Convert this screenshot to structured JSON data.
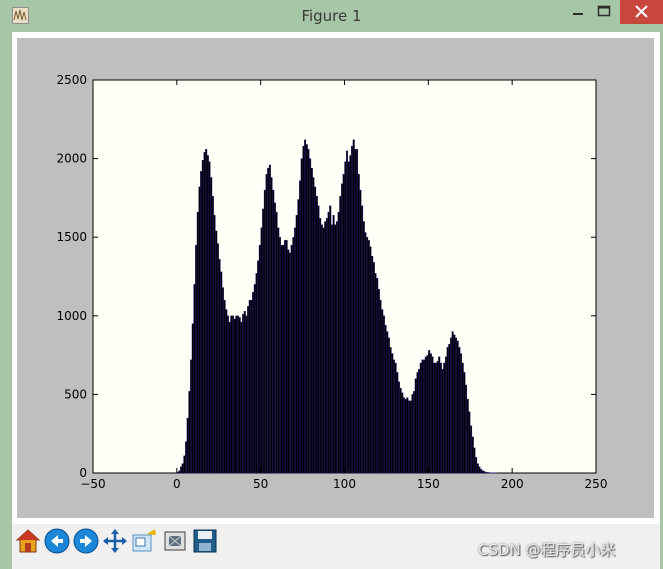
{
  "window": {
    "title": "Figure 1",
    "app_icon": "matplotlib-figure-icon",
    "controls": [
      "minimize-icon",
      "maximize-icon",
      "close-icon"
    ],
    "colors": {
      "frame": "#a7c5a7",
      "close": "#c7463e",
      "canvas_bg": "#bfbfbf"
    }
  },
  "toolbar": {
    "buttons": [
      {
        "name": "home",
        "icon": "home-icon"
      },
      {
        "name": "back",
        "icon": "back-arrow-icon"
      },
      {
        "name": "forward",
        "icon": "forward-arrow-icon"
      },
      {
        "name": "pan",
        "icon": "pan-move-icon"
      },
      {
        "name": "zoom",
        "icon": "zoom-rect-icon"
      },
      {
        "name": "subplots",
        "icon": "configure-subplots-icon"
      },
      {
        "name": "save",
        "icon": "save-floppy-icon"
      }
    ]
  },
  "watermark": "CSDN @程序员小米",
  "chart_data": {
    "type": "bar",
    "title": "",
    "xlabel": "",
    "ylabel": "",
    "xlim": [
      -50,
      250
    ],
    "ylim": [
      0,
      2500
    ],
    "xticks": [
      "−50",
      "0",
      "50",
      "100",
      "150",
      "200",
      "250"
    ],
    "yticks": [
      "0",
      "500",
      "1000",
      "1500",
      "2000",
      "2500"
    ],
    "grid": false,
    "bar_color": "#000000",
    "edge_color": "#2a1b8c",
    "x": [
      0,
      1,
      2,
      3,
      4,
      5,
      6,
      7,
      8,
      9,
      10,
      11,
      12,
      13,
      14,
      15,
      16,
      17,
      18,
      19,
      20,
      21,
      22,
      23,
      24,
      25,
      26,
      27,
      28,
      29,
      30,
      31,
      32,
      33,
      34,
      35,
      36,
      37,
      38,
      39,
      40,
      41,
      42,
      43,
      44,
      45,
      46,
      47,
      48,
      49,
      50,
      51,
      52,
      53,
      54,
      55,
      56,
      57,
      58,
      59,
      60,
      61,
      62,
      63,
      64,
      65,
      66,
      67,
      68,
      69,
      70,
      71,
      72,
      73,
      74,
      75,
      76,
      77,
      78,
      79,
      80,
      81,
      82,
      83,
      84,
      85,
      86,
      87,
      88,
      89,
      90,
      91,
      92,
      93,
      94,
      95,
      96,
      97,
      98,
      99,
      100,
      101,
      102,
      103,
      104,
      105,
      106,
      107,
      108,
      109,
      110,
      111,
      112,
      113,
      114,
      115,
      116,
      117,
      118,
      119,
      120,
      121,
      122,
      123,
      124,
      125,
      126,
      127,
      128,
      129,
      130,
      131,
      132,
      133,
      134,
      135,
      136,
      137,
      138,
      139,
      140,
      141,
      142,
      143,
      144,
      145,
      146,
      147,
      148,
      149,
      150,
      151,
      152,
      153,
      154,
      155,
      156,
      157,
      158,
      159,
      160,
      161,
      162,
      163,
      164,
      165,
      166,
      167,
      168,
      169,
      170,
      171,
      172,
      173,
      174,
      175,
      176,
      177,
      178,
      179,
      180,
      181,
      182,
      183,
      184,
      185,
      186,
      187,
      188,
      189,
      190,
      191,
      192,
      193,
      194,
      195,
      196,
      197,
      198,
      199,
      200,
      201,
      202,
      203,
      204,
      205,
      206,
      207,
      208,
      209,
      210,
      211,
      212,
      213,
      214,
      215,
      216,
      217,
      218,
      219,
      220,
      221,
      222,
      223,
      224,
      225,
      226,
      227,
      228,
      229,
      230,
      231,
      232,
      233,
      234,
      235,
      236,
      237,
      238,
      239,
      240
    ],
    "values": [
      5,
      15,
      40,
      60,
      110,
      200,
      350,
      520,
      720,
      950,
      1200,
      1450,
      1660,
      1820,
      1920,
      1990,
      2040,
      2060,
      2020,
      1980,
      1880,
      1760,
      1640,
      1540,
      1460,
      1360,
      1280,
      1180,
      1100,
      1040,
      1000,
      960,
      1000,
      1000,
      980,
      1000,
      1000,
      990,
      960,
      1010,
      1030,
      1000,
      1060,
      1100,
      1100,
      1150,
      1200,
      1270,
      1350,
      1450,
      1560,
      1680,
      1800,
      1900,
      1940,
      1960,
      1880,
      1800,
      1720,
      1660,
      1560,
      1500,
      1450,
      1450,
      1480,
      1480,
      1420,
      1400,
      1450,
      1500,
      1560,
      1640,
      1740,
      1860,
      2000,
      2080,
      2120,
      2090,
      2060,
      2000,
      1940,
      1880,
      1820,
      1760,
      1700,
      1620,
      1580,
      1560,
      1600,
      1620,
      1660,
      1700,
      1580,
      1640,
      1580,
      1600,
      1660,
      1760,
      1840,
      1900,
      1980,
      2050,
      1980,
      2020,
      2080,
      2120,
      2060,
      2060,
      1900,
      1800,
      1700,
      1600,
      1530,
      1500,
      1480,
      1440,
      1380,
      1340,
      1270,
      1240,
      1170,
      1100,
      1040,
      1000,
      940,
      900,
      860,
      800,
      760,
      720,
      700,
      640,
      580,
      540,
      510,
      480,
      470,
      480,
      460,
      460,
      500,
      520,
      600,
      640,
      660,
      700,
      720,
      720,
      740,
      750,
      780,
      760,
      740,
      700,
      700,
      710,
      740,
      700,
      660,
      700,
      740,
      800,
      820,
      860,
      900,
      880,
      860,
      840,
      800,
      760,
      700,
      640,
      560,
      470,
      390,
      300,
      230,
      160,
      100,
      60,
      40,
      25,
      15,
      10,
      5,
      4,
      3,
      2,
      2,
      1,
      1,
      0,
      0,
      0,
      0,
      0,
      0,
      0,
      0,
      0,
      0,
      0,
      0,
      0,
      0,
      0,
      0,
      0,
      0,
      0,
      0,
      0,
      0,
      0,
      0,
      0,
      0,
      0,
      0,
      0,
      0,
      0,
      0,
      0,
      0,
      0,
      0,
      0,
      0,
      0,
      0,
      0,
      0,
      0,
      0,
      0,
      0,
      0,
      0,
      0,
      0,
      0,
      0,
      0,
      0,
      0,
      0,
      0,
      0,
      0,
      0,
      0
    ]
  }
}
